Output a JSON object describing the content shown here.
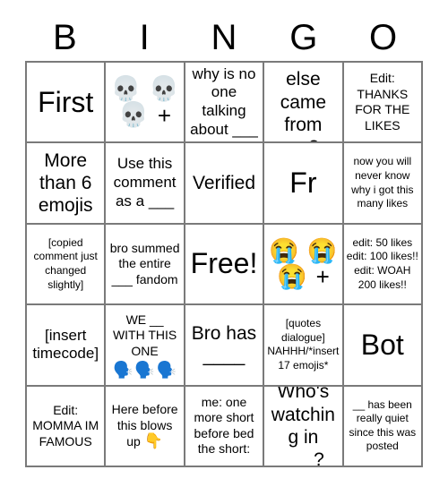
{
  "header": {
    "letters": [
      "B",
      "I",
      "N",
      "G",
      "O"
    ]
  },
  "grid": {
    "rows": 5,
    "columns": 5,
    "border_color": "#7a7a7a",
    "background": "#ffffff",
    "cells": [
      {
        "row": 1,
        "col": 1,
        "name": "cell-first",
        "text": "First",
        "size": "sz-xxl",
        "emojis": []
      },
      {
        "row": 1,
        "col": 2,
        "name": "cell-skull-emojis",
        "text": "",
        "size": "sz-m",
        "emojis": [
          "skull-emoji",
          "skull-emoji",
          "skull-emoji"
        ],
        "emoji_glyphs": [
          "💀",
          "💀",
          "💀"
        ],
        "plus": "+"
      },
      {
        "row": 1,
        "col": 3,
        "name": "cell-why-is-no-one-talking",
        "text": "why is no one talking about ___",
        "size": "sz-m",
        "emojis": []
      },
      {
        "row": 1,
        "col": 4,
        "name": "cell-who-else-came-from",
        "text": "who else came from __?",
        "size": "sz-l",
        "emojis": []
      },
      {
        "row": 1,
        "col": 5,
        "name": "cell-edit-thanks-for-the-likes",
        "text": "Edit: THANKS FOR THE LIKES",
        "size": "sz-s",
        "emojis": []
      },
      {
        "row": 2,
        "col": 1,
        "name": "cell-more-than-6-emojis",
        "text": "More than 6 emojis",
        "size": "sz-l",
        "emojis": []
      },
      {
        "row": 2,
        "col": 2,
        "name": "cell-use-this-comment-as-a",
        "text": "Use this comment as a ___",
        "size": "sz-m",
        "emojis": []
      },
      {
        "row": 2,
        "col": 3,
        "name": "cell-verified",
        "text": "Verified",
        "size": "sz-l",
        "emojis": []
      },
      {
        "row": 2,
        "col": 4,
        "name": "cell-fr",
        "text": "Fr",
        "size": "sz-xxl",
        "emojis": []
      },
      {
        "row": 2,
        "col": 5,
        "name": "cell-now-you-will-never-know",
        "text": "now you will never know why i got this many likes",
        "size": "sz-xs",
        "emojis": []
      },
      {
        "row": 3,
        "col": 1,
        "name": "cell-copied-comment",
        "text": "[copied comment just changed slightly]",
        "size": "sz-xs",
        "emojis": []
      },
      {
        "row": 3,
        "col": 2,
        "name": "cell-bro-summed-the-entire-fandom",
        "text": "bro summed the entire ___ fandom",
        "size": "sz-s",
        "emojis": []
      },
      {
        "row": 3,
        "col": 3,
        "name": "cell-free-space",
        "text": "Free!",
        "size": "sz-xxl",
        "emojis": []
      },
      {
        "row": 3,
        "col": 4,
        "name": "cell-crying-emojis",
        "text": "",
        "size": "sz-m",
        "emojis": [
          "loudly-crying-face-emoji",
          "loudly-crying-face-emoji",
          "loudly-crying-face-emoji"
        ],
        "emoji_glyphs": [
          "😭",
          "😭",
          "😭"
        ],
        "plus": "+"
      },
      {
        "row": 3,
        "col": 5,
        "name": "cell-edit-likes-counts",
        "text": "edit: 50 likes edit: 100 likes!! edit: WOAH 200 likes!!",
        "size": "sz-xs",
        "emojis": []
      },
      {
        "row": 4,
        "col": 1,
        "name": "cell-insert-timecode",
        "text": "[insert timecode]",
        "size": "sz-m",
        "emojis": []
      },
      {
        "row": 4,
        "col": 2,
        "name": "cell-we-with-this-one",
        "text": "WE __ WITH THIS ONE",
        "size": "sz-s",
        "sub_emojis": [
          "speaking-head-emoji",
          "speaking-head-emoji",
          "speaking-head-emoji"
        ],
        "sub_emoji_glyphs": [
          "🗣️",
          "🗣️",
          "🗣️"
        ],
        "emojis": []
      },
      {
        "row": 4,
        "col": 3,
        "name": "cell-bro-has",
        "text": "Bro has ____",
        "size": "sz-l",
        "emojis": []
      },
      {
        "row": 4,
        "col": 4,
        "name": "cell-quotes-dialogue",
        "text": "[quotes dialogue] NAHHH/*insert 17 emojis*",
        "size": "sz-xs",
        "emojis": []
      },
      {
        "row": 4,
        "col": 5,
        "name": "cell-bot",
        "text": "Bot",
        "size": "sz-xxl",
        "emojis": []
      },
      {
        "row": 5,
        "col": 1,
        "name": "cell-edit-momma-im-famous",
        "text": "Edit: MOMMA IM FAMOUS",
        "size": "sz-s",
        "emojis": []
      },
      {
        "row": 5,
        "col": 2,
        "name": "cell-here-before-this-blows-up",
        "text": "Here before this blows up ",
        "size": "sz-s",
        "inline_emoji": "👇",
        "inline_emoji_name": "backhand-index-pointing-down-emoji",
        "emojis": []
      },
      {
        "row": 5,
        "col": 3,
        "name": "cell-me-one-more-short",
        "text": "me: one more short before bed the short:",
        "size": "sz-s",
        "emojis": []
      },
      {
        "row": 5,
        "col": 4,
        "name": "cell-whos-watching-in",
        "text": "Who's watching in ___?",
        "size": "sz-l",
        "emojis": []
      },
      {
        "row": 5,
        "col": 5,
        "name": "cell-has-been-really-quiet",
        "text": "__ has been really quiet since this was posted",
        "size": "sz-xs",
        "emojis": []
      }
    ]
  }
}
